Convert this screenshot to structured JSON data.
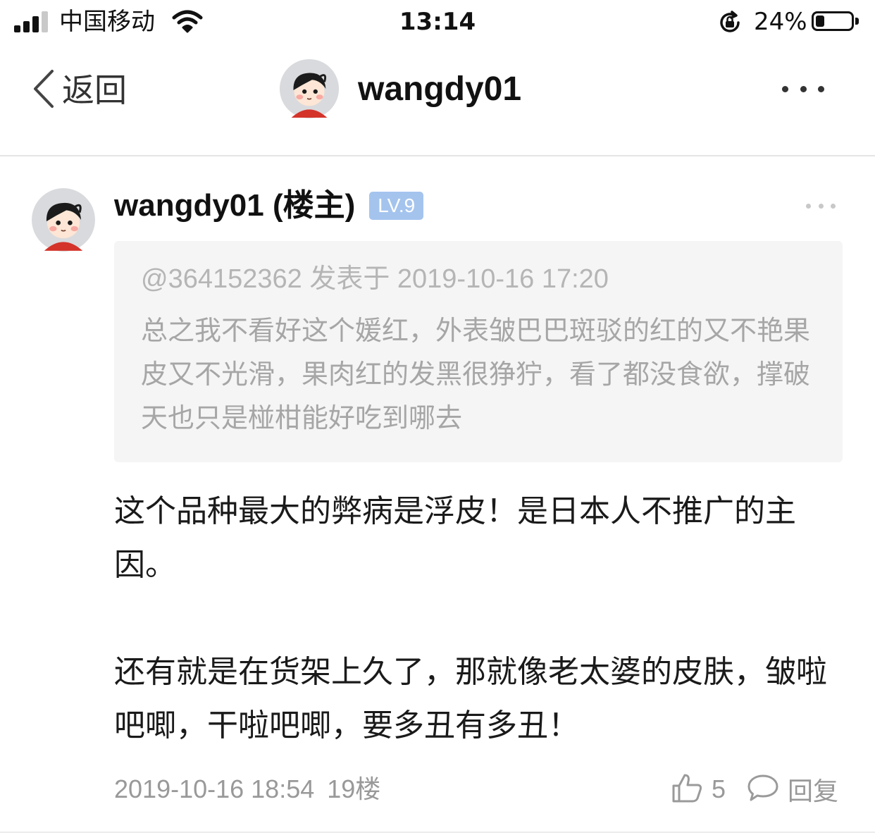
{
  "status_bar": {
    "carrier": "中国移动",
    "time": "13:14",
    "battery_percent": "24%",
    "battery_level": 0.24
  },
  "nav": {
    "back_label": "返回",
    "title": "wangdy01"
  },
  "post": {
    "author": "wangdy01 (楼主)",
    "level": "LV.9",
    "quote": {
      "meta": "@364152362 发表于 2019-10-16 17:20",
      "text": "总之我不看好这个媛红，外表皱巴巴斑驳的红的又不艳果皮又不光滑，果肉红的发黑很狰狞，看了都没食欲，撑破天也只是椪柑能好吃到哪去"
    },
    "paragraphs": [
      "这个品种最大的弊病是浮皮！是日本人不推广的主因。",
      "还有就是在货架上久了，那就像老太婆的皮肤，皱啦吧唧，干啦吧唧，要多丑有多丑！"
    ],
    "datetime": "2019-10-16 18:54",
    "floor": "19楼",
    "like_count": "5",
    "reply_label": "回复"
  },
  "colors": {
    "level_badge": "#a4c4ee",
    "quote_background": "#f5f5f5",
    "secondary_text": "#999999"
  },
  "icons": {
    "signal": "signal-bars-icon",
    "wifi": "wifi-icon",
    "orientation_lock": "orientation-lock-icon",
    "battery": "battery-icon",
    "back": "chevron-left-icon",
    "more": "more-dots-icon",
    "like": "thumbs-up-icon",
    "reply": "speech-bubble-icon"
  }
}
